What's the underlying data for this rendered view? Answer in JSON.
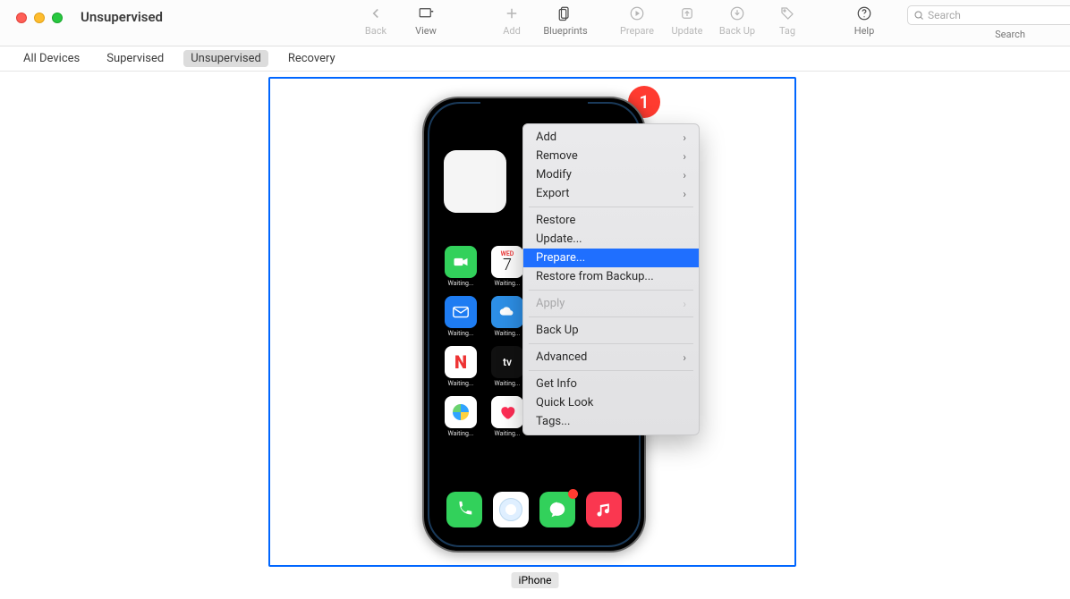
{
  "window": {
    "title": "Unsupervised"
  },
  "toolbar": {
    "back": {
      "label": "Back"
    },
    "view": {
      "label": "View"
    },
    "add": {
      "label": "Add"
    },
    "blueprints": {
      "label": "Blueprints"
    },
    "prepare": {
      "label": "Prepare"
    },
    "update": {
      "label": "Update"
    },
    "backup": {
      "label": "Back Up"
    },
    "tag": {
      "label": "Tag"
    },
    "help": {
      "label": "Help"
    },
    "search": {
      "label": "Search",
      "placeholder": "Search"
    }
  },
  "filters": [
    {
      "label": "All Devices",
      "active": false
    },
    {
      "label": "Supervised",
      "active": false
    },
    {
      "label": "Unsupervised",
      "active": true
    },
    {
      "label": "Recovery",
      "active": false
    }
  ],
  "device": {
    "caption": "iPhone",
    "badge": "1",
    "apps": [
      {
        "label": "Waiting...",
        "icon": "facetime"
      },
      {
        "label": "Waiting...",
        "icon": "calendar"
      },
      {
        "label": "Waiting...",
        "icon": "mail"
      },
      {
        "label": "Waiting...",
        "icon": "weather"
      },
      {
        "label": "Waiting...",
        "icon": "news"
      },
      {
        "label": "Waiting...",
        "icon": "tv"
      },
      {
        "label": "Waiting...",
        "icon": "maps"
      },
      {
        "label": "Waiting...",
        "icon": "health"
      }
    ],
    "dock": [
      {
        "icon": "phone"
      },
      {
        "icon": "safari"
      },
      {
        "icon": "messages"
      },
      {
        "icon": "music"
      }
    ],
    "app_labels": {
      "tv": "tv",
      "calendar_top": "WED",
      "calendar_num": "7"
    }
  },
  "context_menu": [
    {
      "label": "Add",
      "submenu": true
    },
    {
      "label": "Remove",
      "submenu": true
    },
    {
      "label": "Modify",
      "submenu": true
    },
    {
      "label": "Export",
      "submenu": true
    },
    {
      "sep": true
    },
    {
      "label": "Restore"
    },
    {
      "label": "Update..."
    },
    {
      "label": "Prepare...",
      "selected": true
    },
    {
      "label": "Restore from Backup..."
    },
    {
      "sep": true
    },
    {
      "label": "Apply",
      "submenu": true,
      "disabled": true
    },
    {
      "sep": true
    },
    {
      "label": "Back Up"
    },
    {
      "sep": true
    },
    {
      "label": "Advanced",
      "submenu": true
    },
    {
      "sep": true
    },
    {
      "label": "Get Info"
    },
    {
      "label": "Quick Look"
    },
    {
      "label": "Tags..."
    }
  ]
}
